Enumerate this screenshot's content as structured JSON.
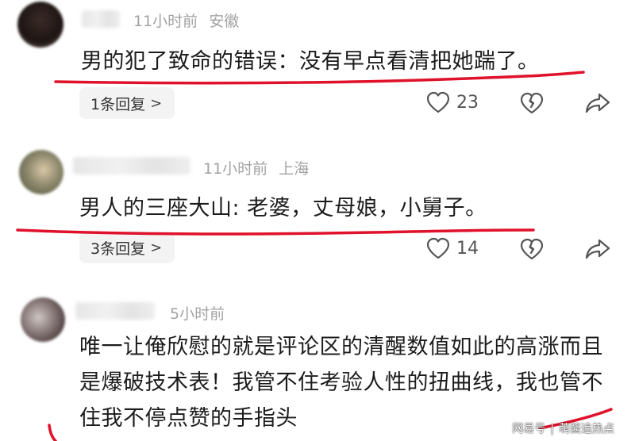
{
  "comments": [
    {
      "time": "11小时前",
      "location": "安徽",
      "text": "男的犯了致命的错误：没有早点看清把她踹了。",
      "replies": "1条回复",
      "likes": "23"
    },
    {
      "time": "11小时前",
      "location": "上海",
      "text": "男人的三座大山: 老婆，丈母娘，小舅子。",
      "replies": "3条回复",
      "likes": "14"
    },
    {
      "time": "5小时前",
      "text": "唯一让俺欣慰的就是评论区的清醒数值如此的高涨而且是爆破技术表！我管不住考验人性的扭曲线，我也管不住我不停点赞的手指头"
    }
  ],
  "watermark": {
    "source": "网易号",
    "author": "萌酱追热点"
  },
  "colors": {
    "underline": "#e0112b",
    "meta": "#a2a2a2",
    "pill_bg": "#f3f3f3"
  }
}
